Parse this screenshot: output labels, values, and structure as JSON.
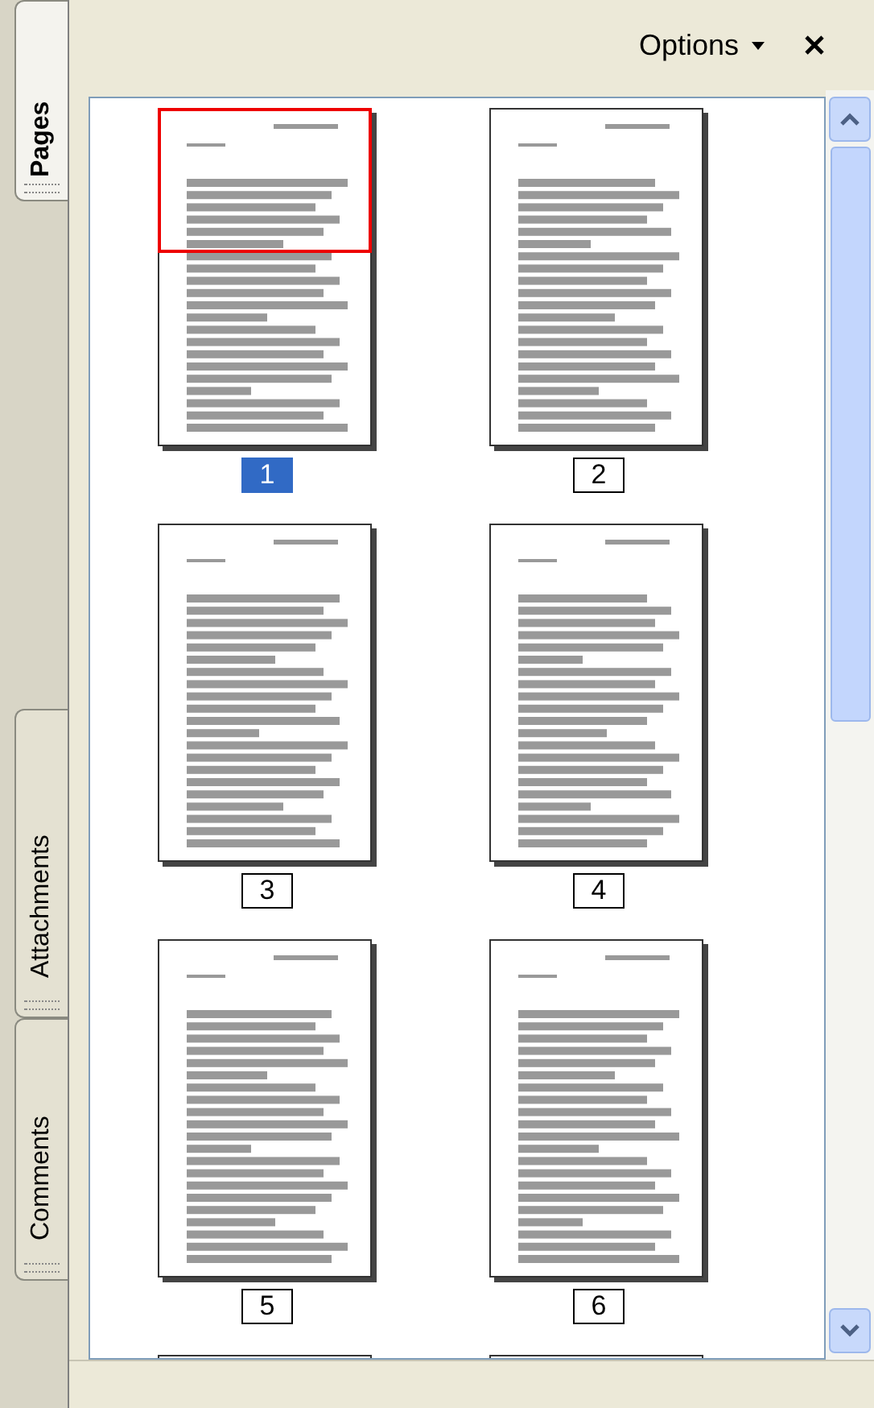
{
  "side_tabs": [
    {
      "label": "Pages",
      "selected": true
    },
    {
      "label": "Attachments",
      "selected": false
    },
    {
      "label": "Comments",
      "selected": false
    }
  ],
  "header": {
    "options_label": "Options"
  },
  "pages": [
    {
      "kind": "full",
      "label": "1",
      "selected": true,
      "in_view": true
    },
    {
      "kind": "full",
      "label": "2",
      "selected": false,
      "in_view": false
    },
    {
      "kind": "full",
      "label": "3",
      "selected": false,
      "in_view": false
    },
    {
      "kind": "full",
      "label": "4",
      "selected": false,
      "in_view": false
    },
    {
      "kind": "full",
      "label": "5",
      "selected": false,
      "in_view": false
    },
    {
      "kind": "full",
      "label": "6",
      "selected": false,
      "in_view": false
    },
    {
      "kind": "partial"
    },
    {
      "kind": "partial"
    }
  ]
}
